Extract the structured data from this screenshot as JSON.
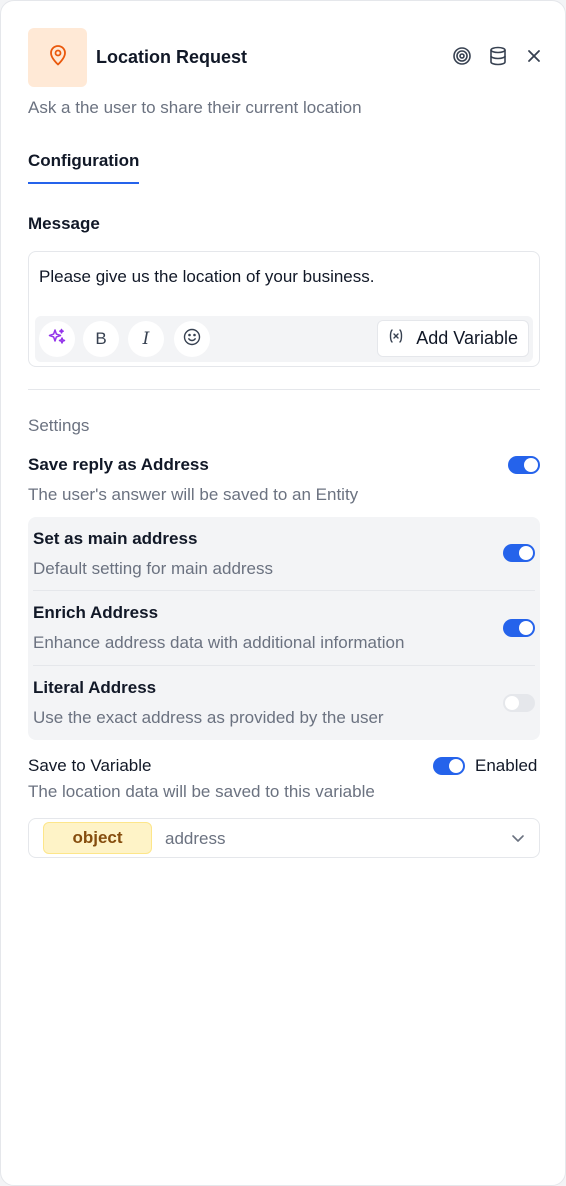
{
  "header": {
    "title": "Location Request",
    "subtitle": "Ask a the user to share their current location",
    "icon": "map-pin-icon",
    "accent_color": "#ea580c",
    "actions": [
      "target-icon",
      "database-icon",
      "close-icon"
    ]
  },
  "tabs": [
    {
      "label": "Configuration",
      "active": true
    }
  ],
  "message": {
    "label": "Message",
    "text": "Please give us the location of your business.",
    "toolbar": {
      "tools": [
        "sparkles-icon",
        "bold-icon",
        "italic-icon",
        "emoji-icon"
      ],
      "bold_glyph": "B",
      "italic_glyph": "I",
      "add_variable_label": "Add Variable"
    }
  },
  "settings": {
    "label": "Settings",
    "save_reply": {
      "title": "Save reply as Address",
      "description": "The user's answer will be saved to an Entity",
      "enabled": true
    },
    "options": [
      {
        "title": "Set as main address",
        "description": "Default setting for main address",
        "enabled": true
      },
      {
        "title": "Enrich Address",
        "description": "Enhance address data with additional information",
        "enabled": true
      },
      {
        "title": "Literal Address",
        "description": "Use the exact address as provided by the user",
        "enabled": false
      }
    ],
    "save_to_variable": {
      "title": "Save to Variable",
      "description": "The location data will be saved to this variable",
      "enabled": true,
      "enabled_label": "Enabled",
      "type": "object",
      "variable": "address"
    }
  },
  "colors": {
    "primary": "#2563eb",
    "badge_bg": "#fef3c7",
    "badge_text": "#854d0e",
    "icon_box": "#ffe9d6"
  }
}
